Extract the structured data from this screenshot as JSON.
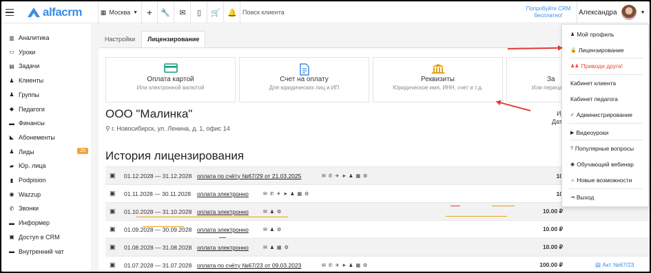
{
  "app": {
    "logo_text": "alfacrm",
    "branch": "Москва",
    "search_placeholder": "Поиск клиента",
    "try_text": "Попробуйте CRM бесплатно!",
    "user_name": "Александра"
  },
  "sidebar": {
    "items": [
      {
        "label": "Аналитика",
        "icon": "analytics-icon"
      },
      {
        "label": "Уроки",
        "icon": "calendar-icon"
      },
      {
        "label": "Задачи",
        "icon": "tasks-icon"
      },
      {
        "label": "Клиенты",
        "icon": "user-icon"
      },
      {
        "label": "Группы",
        "icon": "users-icon"
      },
      {
        "label": "Педагоги",
        "icon": "graduation-cap-icon"
      },
      {
        "label": "Финансы",
        "icon": "money-icon"
      },
      {
        "label": "Абонементы",
        "icon": "tag-icon"
      },
      {
        "label": "Лиды",
        "icon": "leads-icon",
        "badge": "25"
      },
      {
        "label": "Юр. лица",
        "icon": "briefcase-icon"
      },
      {
        "label": "Podpision",
        "icon": "document-icon"
      },
      {
        "label": "Wazzup",
        "icon": "whatsapp-icon"
      },
      {
        "label": "Звонки",
        "icon": "phone-icon"
      },
      {
        "label": "Информер",
        "icon": "informer-icon"
      },
      {
        "label": "Доступ в CRM",
        "icon": "lock-icon"
      },
      {
        "label": "Внутренний чат",
        "icon": "chat-icon"
      }
    ]
  },
  "tabs": [
    {
      "label": "Настройки"
    },
    {
      "label": "Лицензирование"
    }
  ],
  "cards": [
    {
      "title": "Оплата картой",
      "sub": "Или электронной валютой",
      "icon": "credit-card-icon"
    },
    {
      "title": "Счет на оплату",
      "sub": "Для юридических лиц и ИП",
      "icon": "invoice-icon"
    },
    {
      "title": "Реквизиты",
      "sub": "Юридическое имя, ИНН, счет и т.д.",
      "icon": "bank-icon"
    },
    {
      "title": "За",
      "sub": "Или период",
      "icon": "calendar-icon"
    }
  ],
  "org": {
    "name": "ООО \"Малинка\"",
    "address": "г. Новосибирск, ул. Ленина, д. 1, офис 14",
    "right1": "Ид",
    "right2": "Дат"
  },
  "history": {
    "title": "История лицензирования",
    "rows": [
      {
        "period": "01.12.2028 — 31.12.2028",
        "link": "оплата по счёту №67/29 от 21.03.2025",
        "icons": "✉ ✆ ✈ ➤ ♟ ▦ ⚙",
        "amount": "10",
        "act": ""
      },
      {
        "period": "01.11.2028 — 30.11.2028",
        "link": "оплата электронно",
        "icons": "✉ ✆ ✈ ➤ ♟ ▦ ⚙",
        "amount": "10",
        "act": ""
      },
      {
        "period": "01.10.2028 — 31.10.2028",
        "link": "оплата электронно",
        "icons": "✉ ♟ ⚙",
        "amount": "10.00 ₽",
        "act": ""
      },
      {
        "period": "01.09.2028 — 30.09.2028",
        "link": "оплата электронно",
        "icons": "✉ ♟ ⚙",
        "amount": "10.00 ₽",
        "act": ""
      },
      {
        "period": "01.08.2028 — 31.08.2028",
        "link": "оплата электронно",
        "icons": "✉ ♟ ▦ ⚙",
        "amount": "10.00 ₽",
        "act": ""
      },
      {
        "period": "01.07.2028 — 31.07.2028",
        "link": "оплата по счёту №67/23 от 09.03.2023",
        "icons": "✉ ✆ ✈ ➤ ♟ ▦ ⚙",
        "amount": "100.00 ₽",
        "act": "Акт №67/23"
      }
    ]
  },
  "dropdown": {
    "items": [
      {
        "label": "Мой профиль",
        "icon": "user-icon"
      },
      {
        "label": "Лицензирование",
        "icon": "lock-icon"
      },
      {
        "label": "Приводи друга!",
        "icon": "friends-icon"
      },
      {
        "label": "Кабинет клиента",
        "icon": ""
      },
      {
        "label": "Кабинет педагога",
        "icon": ""
      },
      {
        "label": "Администрирование",
        "icon": "check-icon"
      },
      {
        "label": "Видеоуроки",
        "icon": "video-icon"
      },
      {
        "label": "Популярные вопросы",
        "icon": "question-icon"
      },
      {
        "label": "Обучающий вебинар",
        "icon": "webinar-icon"
      },
      {
        "label": "Новые возможности",
        "icon": "sun-icon"
      },
      {
        "label": "Выход",
        "icon": "exit-icon"
      }
    ]
  }
}
